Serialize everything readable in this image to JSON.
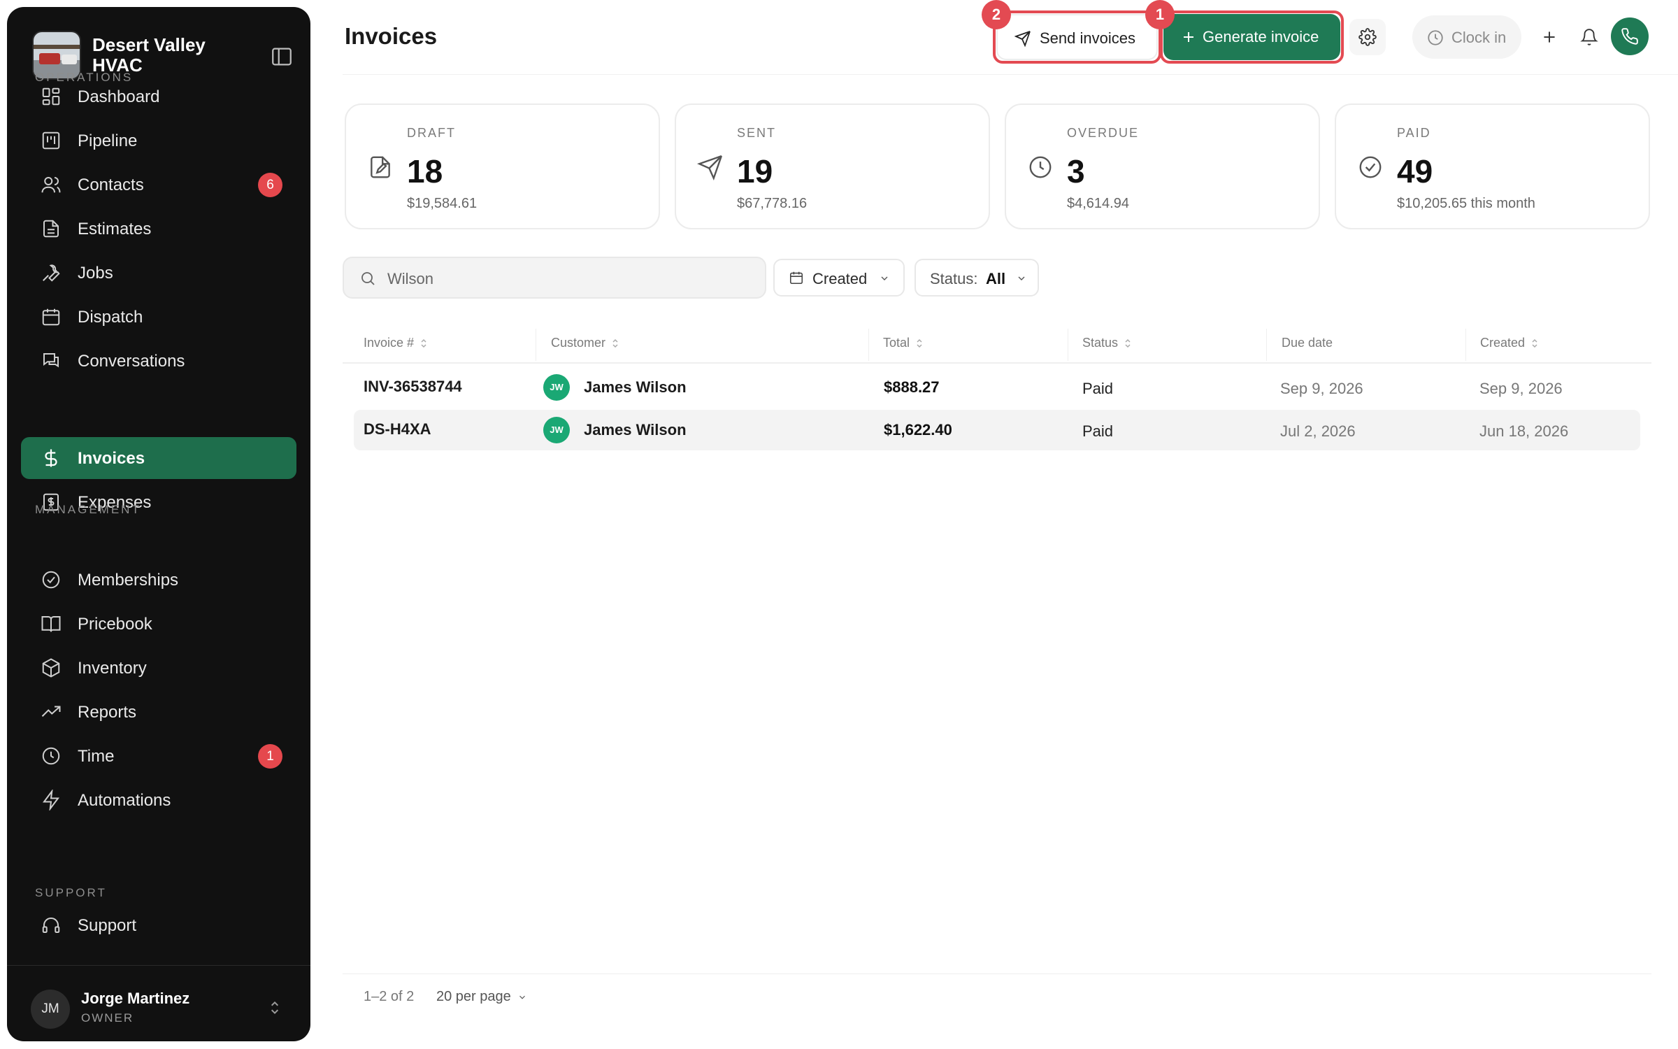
{
  "sidebar": {
    "brand_name": "Desert Valley HVAC",
    "sections": {
      "operations": "OPERATIONS",
      "management": "MANAGEMENT",
      "support": "SUPPORT"
    },
    "items": [
      {
        "label": "Dashboard",
        "icon": "dashboard-icon"
      },
      {
        "label": "Pipeline",
        "icon": "pipeline-icon"
      },
      {
        "label": "Contacts",
        "icon": "contacts-icon",
        "badge": "6"
      },
      {
        "label": "Estimates",
        "icon": "estimates-icon"
      },
      {
        "label": "Jobs",
        "icon": "wrench-icon"
      },
      {
        "label": "Dispatch",
        "icon": "calendar-icon"
      },
      {
        "label": "Conversations",
        "icon": "chat-icon"
      },
      {
        "label": "Invoices",
        "icon": "dollar-icon",
        "active": true
      },
      {
        "label": "Expenses",
        "icon": "receipt-icon"
      },
      {
        "label": "Memberships",
        "icon": "badge-check-icon"
      },
      {
        "label": "Pricebook",
        "icon": "book-icon"
      },
      {
        "label": "Inventory",
        "icon": "box-icon"
      },
      {
        "label": "Reports",
        "icon": "trending-icon"
      },
      {
        "label": "Time",
        "icon": "clock-icon",
        "badge": "1"
      },
      {
        "label": "Automations",
        "icon": "bolt-icon"
      },
      {
        "label": "Support",
        "icon": "headset-icon"
      }
    ],
    "user": {
      "initials": "JM",
      "name": "Jorge Martinez",
      "role": "OWNER"
    }
  },
  "header": {
    "title": "Invoices",
    "send_label": "Send invoices",
    "generate_label": "Generate invoice",
    "clock_label": "Clock in",
    "annotations": [
      "2",
      "1"
    ]
  },
  "stats": [
    {
      "label": "DRAFT",
      "count": "18",
      "amount": "$19,584.61",
      "icon": "draft-file-icon"
    },
    {
      "label": "SENT",
      "count": "19",
      "amount": "$67,778.16",
      "icon": "send-icon"
    },
    {
      "label": "OVERDUE",
      "count": "3",
      "amount": "$4,614.94",
      "icon": "clock-icon"
    },
    {
      "label": "PAID",
      "count": "49",
      "amount": "$10,205.65 this month",
      "icon": "check-circle-icon"
    }
  ],
  "filters": {
    "search_value": "Wilson",
    "created_label": "Created",
    "status_label": "Status:",
    "status_value": "All"
  },
  "table": {
    "columns": [
      "Invoice #",
      "Customer",
      "Total",
      "Status",
      "Due date",
      "Created"
    ],
    "rows": [
      {
        "invoice": "INV-36538744",
        "initials": "JW",
        "customer": "James Wilson",
        "total": "$888.27",
        "status": "Paid",
        "due": "Sep 9, 2026",
        "created": "Sep 9, 2026"
      },
      {
        "invoice": "DS-H4XA",
        "initials": "JW",
        "customer": "James Wilson",
        "total": "$1,622.40",
        "status": "Paid",
        "due": "Jul 2, 2026",
        "created": "Jun 18, 2026"
      }
    ]
  },
  "footer": {
    "range": "1–2 of 2",
    "per_page": "20 per page"
  },
  "colors": {
    "accent": "#1f7a55",
    "sidebar_bg": "#111111",
    "highlight": "#e34a52",
    "badge": "#e5484d"
  }
}
